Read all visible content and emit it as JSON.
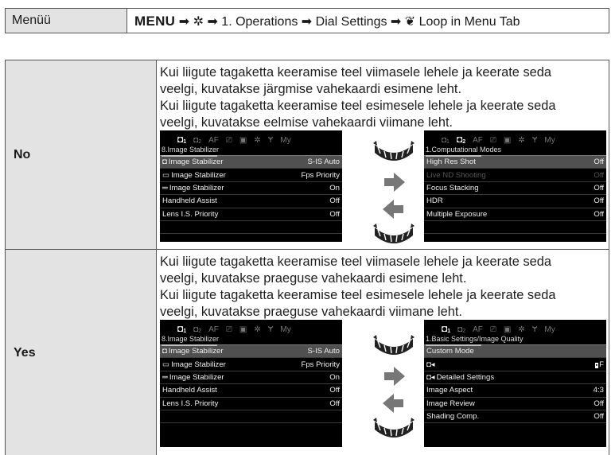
{
  "menu": {
    "label": "Menüü",
    "path_bold": "MENU",
    "path_rest": "1. Operations ➡ Dial Settings ➡ ",
    "path_end": " Loop in Menu Tab"
  },
  "rows": [
    {
      "label": "No",
      "paragraphs": [
        "Kui liigute tagaketta keeramise teel viimasele lehele ja keerate seda",
        "veelgi, kuvatakse järgmise vahekaardi esimene leht.",
        "Kui liigute tagaketta keeramise teel esimesele lehele ja keerate seda",
        "veelgi, kuvatakse eelmise vahekaardi viimane leht."
      ],
      "screen_left": {
        "section": "8.Image Stabilizer",
        "rows": [
          {
            "icon": "camera-icon",
            "label": "Image Stabilizer",
            "value": "S-IS Auto"
          },
          {
            "icon": "video-icon",
            "label": "Image Stabilizer",
            "value": "Fps Priority"
          },
          {
            "icon": "lines-icon",
            "label": "Image Stabilizer",
            "value": "On"
          },
          {
            "label": "Handheld Assist",
            "value": "Off"
          },
          {
            "label": "Lens I.S. Priority",
            "value": "Off"
          }
        ]
      },
      "screen_right": {
        "section": "1.Computational Modes",
        "rows": [
          {
            "label": "High Res Shot",
            "value": "Off"
          },
          {
            "label": "Live ND Shooting",
            "value": "Off",
            "dim": true
          },
          {
            "label": "Focus Stacking",
            "value": "Off"
          },
          {
            "label": "HDR",
            "value": "Off"
          },
          {
            "label": "Multiple Exposure",
            "value": "Off"
          }
        ]
      }
    },
    {
      "label": "Yes",
      "paragraphs": [
        "Kui liigute tagaketta keeramise teel viimasele lehele ja keerate seda",
        "veelgi, kuvatakse praeguse vahekaardi esimene leht.",
        "Kui liigute tagaketta keeramise teel esimesele lehele ja keerate seda",
        "veelgi, kuvatakse praeguse vahekaardi viimane leht."
      ],
      "screen_left": {
        "section": "8.Image Stabilizer",
        "rows": [
          {
            "icon": "camera-icon",
            "label": "Image Stabilizer",
            "value": "S-IS Auto"
          },
          {
            "icon": "video-icon",
            "label": "Image Stabilizer",
            "value": "Fps Priority"
          },
          {
            "icon": "lines-icon",
            "label": "Image Stabilizer",
            "value": "On"
          },
          {
            "label": "Handheld Assist",
            "value": "Off"
          },
          {
            "label": "Lens I.S. Priority",
            "value": "Off"
          }
        ]
      },
      "screen_right": {
        "section": "1.Basic Settings/Image Quality",
        "rows": [
          {
            "label": "Custom Mode",
            "value": ""
          },
          {
            "icon": "camera-sound-icon",
            "label": "",
            "value": "F"
          },
          {
            "icon": "camera-sound-icon",
            "label": "Detailed Settings",
            "value": ""
          },
          {
            "label": "Image Aspect",
            "value": "4:3"
          },
          {
            "label": "Image Review",
            "value": "Off"
          },
          {
            "label": "Shading Comp.",
            "value": "Off"
          }
        ]
      }
    }
  ],
  "tabs": {
    "af": "AF",
    "my": "My"
  }
}
